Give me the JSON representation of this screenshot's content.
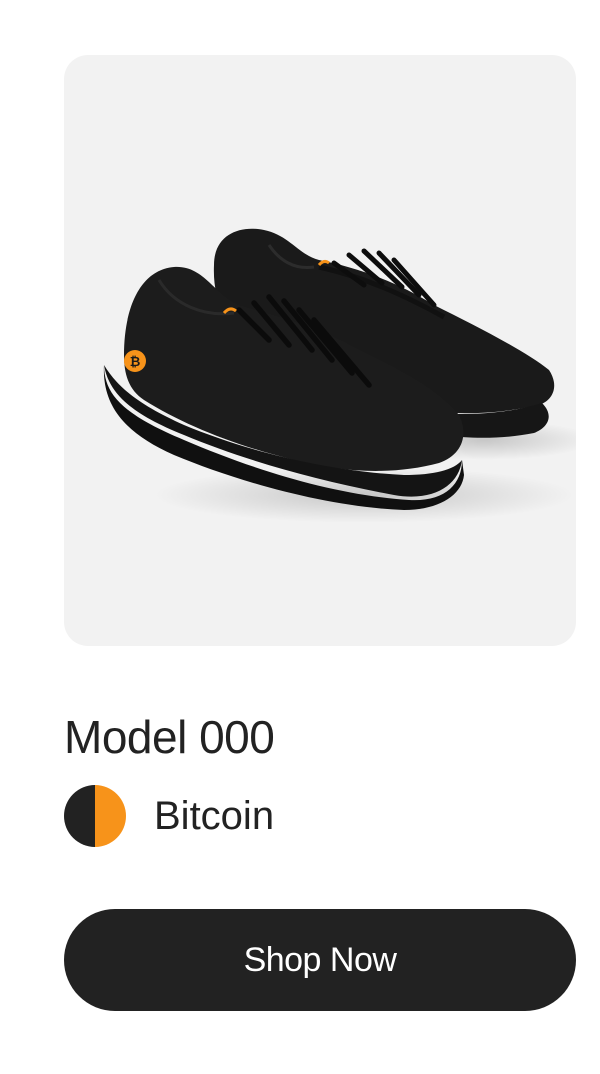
{
  "product": {
    "name": "Model 000",
    "image_icon": "sneaker-pair-image",
    "color": {
      "label": "Bitcoin",
      "swatch_left": "#222222",
      "swatch_right": "#f7931a"
    }
  },
  "actions": {
    "shop_label": "Shop Now"
  },
  "colors": {
    "card_background": "#f2f2f2",
    "button_background": "#222222",
    "button_text": "#ffffff",
    "accent": "#f7931a"
  }
}
